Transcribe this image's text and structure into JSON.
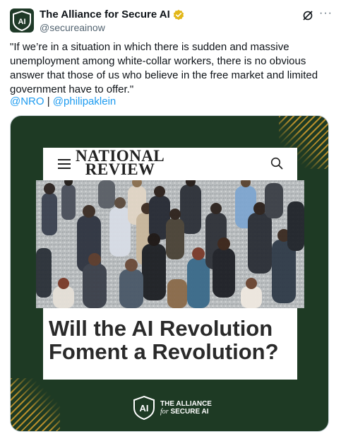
{
  "account": {
    "display_name": "The Alliance for Secure AI",
    "handle": "@secureainow",
    "avatar_text": "AI"
  },
  "tweet": {
    "text": "\"If we’re in a situation in which there is sudden and massive unemployment among white-collar workers, there is no obvious answer that those of us who believe in the free market and limited government have to offer.\"",
    "mention_1": "@NRO",
    "separator": " | ",
    "mention_2": "@philipaklein"
  },
  "article": {
    "publication_line1": "NATIONAL",
    "publication_line2": "REVIEW",
    "headline": "Will the AI Revolution Foment a Revolution?"
  },
  "org_logo": {
    "mark": "AI",
    "line1": "THE ALLIANCE",
    "line2_for": "for",
    "line2_rest": " SECURE AI"
  },
  "colors": {
    "media_bg": "#1e3a24",
    "accent_gold": "#c99a2e",
    "link": "#1d9bf0",
    "verified": "#e2b719"
  },
  "icons": [
    "verified-badge-icon",
    "grok-icon",
    "more-icon",
    "menu-icon",
    "search-icon"
  ]
}
